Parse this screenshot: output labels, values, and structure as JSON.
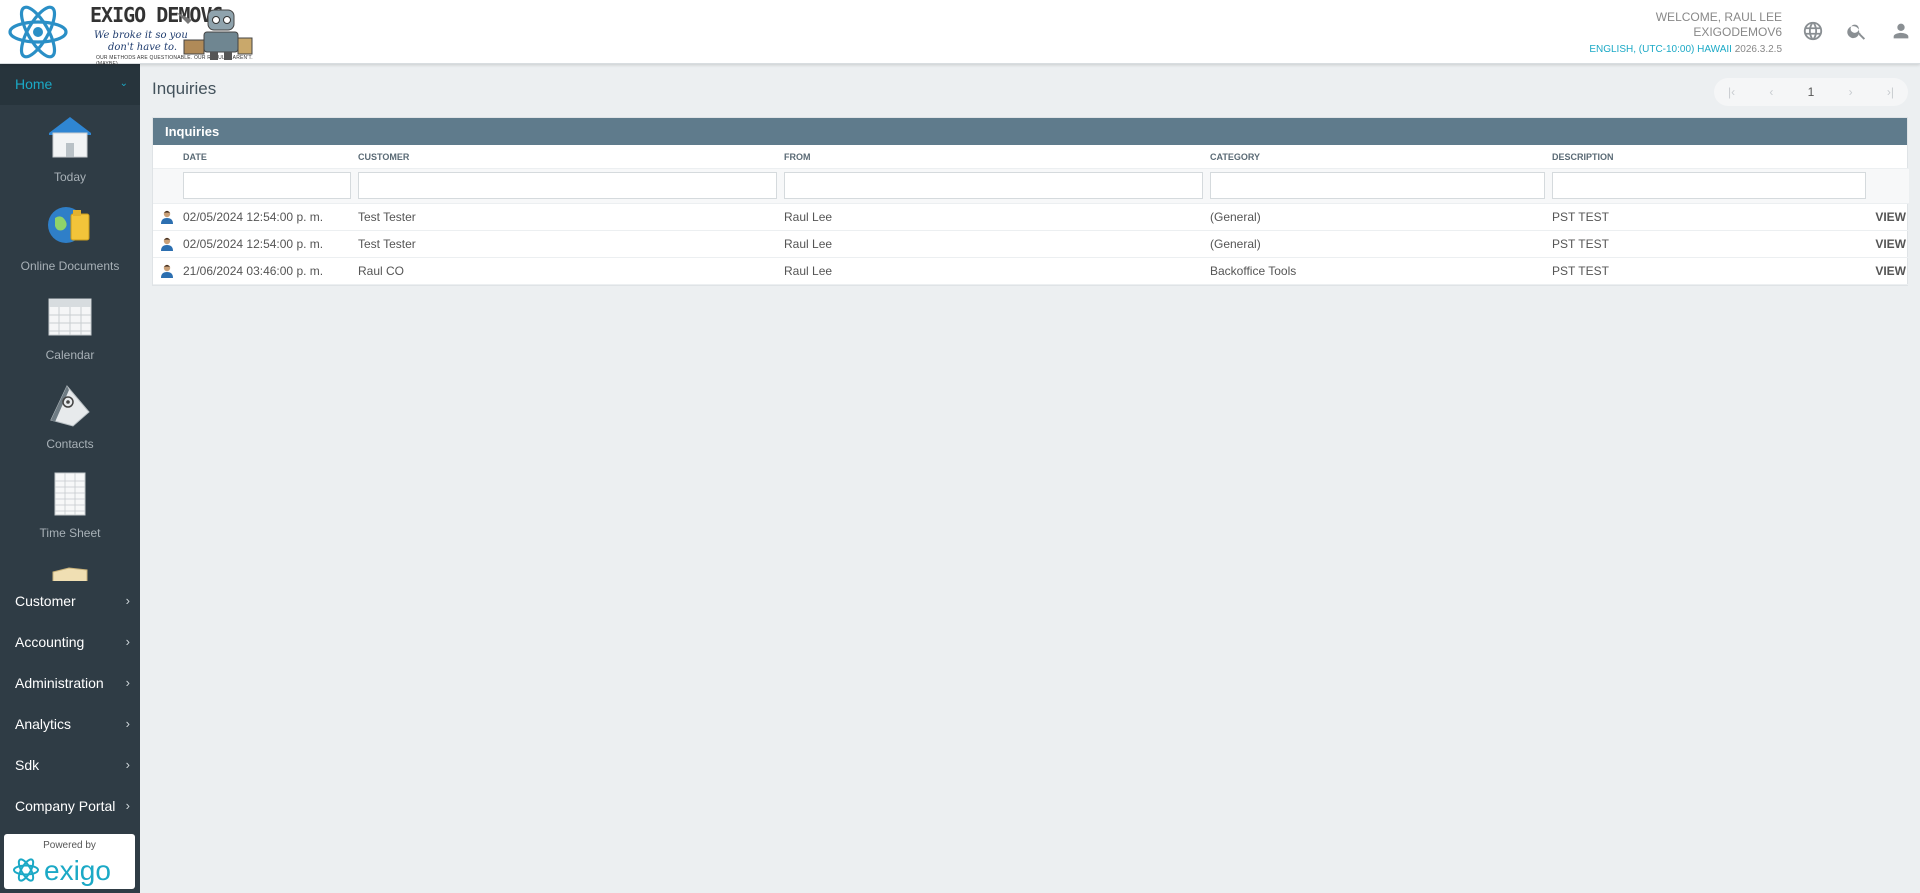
{
  "header": {
    "logo_title": "EXIGO DEMOV6",
    "logo_tagline_1": "We broke it so you",
    "logo_tagline_2": "don't have to.",
    "logo_subtag": "OUR METHODS ARE QUESTIONABLE. OUR RESULTS AREN'T. (MAYBE)",
    "welcome": "WELCOME, RAUL LEE",
    "company": "EXIGODEMOV6",
    "locale": "ENGLISH, (UTC-10:00) HAWAII",
    "version": "2026.3.2.5"
  },
  "sidebar": {
    "home_label": "Home",
    "apps": [
      {
        "label": "Today",
        "icon": "house-icon"
      },
      {
        "label": "Online Documents",
        "icon": "globe-folder-icon"
      },
      {
        "label": "Calendar",
        "icon": "calendar-icon"
      },
      {
        "label": "Contacts",
        "icon": "contacts-icon"
      },
      {
        "label": "Time Sheet",
        "icon": "timesheet-icon"
      }
    ],
    "nav_items": [
      "Customer",
      "Accounting",
      "Administration",
      "Analytics",
      "Sdk",
      "Company Portal"
    ],
    "powered_by": "Powered by",
    "powered_brand": "exigo"
  },
  "main": {
    "page_title": "Inquiries",
    "pager": {
      "first": "|<",
      "prev": "<",
      "page": "1",
      "next": ">",
      "last": ">|"
    },
    "panel_title": "Inquiries",
    "columns": [
      "DATE",
      "CUSTOMER",
      "FROM",
      "CATEGORY",
      "DESCRIPTION"
    ],
    "rows": [
      {
        "date": "02/05/2024 12:54:00 p. m.",
        "customer": "Test Tester",
        "from": "Raul Lee",
        "category": "(General)",
        "description": "PST TEST",
        "action": "VIEW"
      },
      {
        "date": "02/05/2024 12:54:00 p. m.",
        "customer": "Test Tester",
        "from": "Raul Lee",
        "category": "(General)",
        "description": "PST TEST",
        "action": "VIEW"
      },
      {
        "date": "21/06/2024 03:46:00 p. m.",
        "customer": "Raul CO",
        "from": "Raul Lee",
        "category": "Backoffice Tools",
        "description": "PST TEST",
        "action": "VIEW"
      }
    ]
  }
}
